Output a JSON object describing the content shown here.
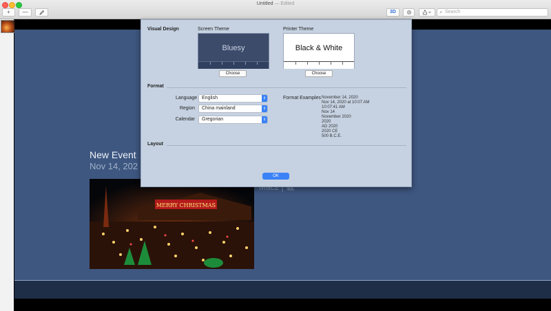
{
  "window": {
    "title": "Untitled",
    "title_suffix": "— Edited"
  },
  "toolbar": {
    "add_label": "+",
    "remove_label": "—",
    "edit_icon": "pencil-icon",
    "mode_3d_label": "3D",
    "gear_icon": "gear-icon",
    "share_icon": "share-icon",
    "search_placeholder": "Search"
  },
  "event": {
    "title": "New Event",
    "date": "Nov 14, 202",
    "location": "Mac2 | 载"
  },
  "dialog": {
    "visual_design_label": "Visual Design",
    "screen_theme_label": "Screen Theme",
    "screen_theme_name": "Bluesy",
    "printer_theme_label": "Printer Theme",
    "printer_theme_name": "Black & White",
    "choose_label": "Choose",
    "format_label": "Format",
    "language_label": "Language",
    "language_value": "English",
    "region_label": "Region",
    "region_value": "China mainland",
    "calendar_label": "Calendar",
    "calendar_value": "Gregorian",
    "format_examples_label": "Format Examples",
    "format_examples": [
      "November 14, 2020",
      "Nov 14, 2020 at 10:07 AM",
      "10:07:41 AM",
      "Nov 14",
      "November 2020",
      "2020",
      "AD 2020",
      "2020 CE",
      "500 B.C.E."
    ],
    "layout_label": "Layout",
    "ok_label": "OK"
  },
  "colors": {
    "dialog_bg": "#c6d2e2",
    "main_bg": "#3e5780",
    "accent": "#3b82f6"
  }
}
